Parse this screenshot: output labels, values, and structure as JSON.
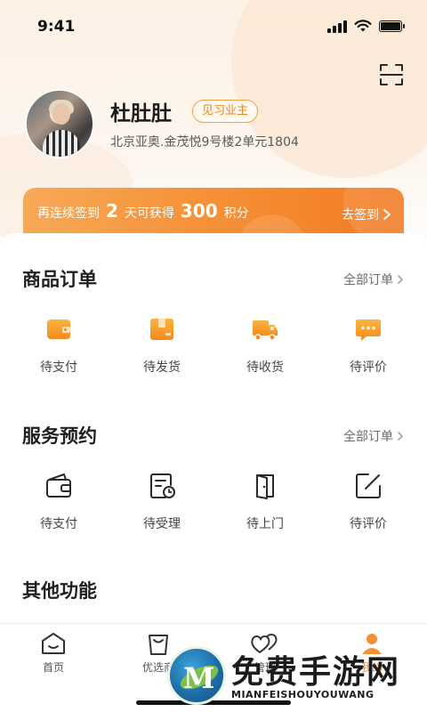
{
  "status_bar": {
    "time": "9:41"
  },
  "profile": {
    "name": "杜肚肚",
    "badge": "见习业主",
    "address": "北京亚奥.金茂悦9号楼2单元1804"
  },
  "signin": {
    "prefix": "再连续签到",
    "days": "2",
    "middle": "天可获得",
    "points": "300",
    "suffix": "积分",
    "action": "去签到"
  },
  "orders": {
    "title": "商品订单",
    "link": "全部订单",
    "items": [
      {
        "label": "待支付",
        "icon": "wallet-icon"
      },
      {
        "label": "待发货",
        "icon": "package-icon"
      },
      {
        "label": "待收货",
        "icon": "truck-icon"
      },
      {
        "label": "待评价",
        "icon": "comment-icon"
      }
    ]
  },
  "services": {
    "title": "服务预约",
    "link": "全部订单",
    "items": [
      {
        "label": "待支付",
        "icon": "wallet-outline-icon"
      },
      {
        "label": "待受理",
        "icon": "schedule-icon"
      },
      {
        "label": "待上门",
        "icon": "door-icon"
      },
      {
        "label": "待评价",
        "icon": "edit-icon"
      }
    ]
  },
  "other": {
    "title": "其他功能"
  },
  "bottom_nav": [
    {
      "label": "首页",
      "icon": "home-icon"
    },
    {
      "label": "优选商",
      "icon": "bag-icon"
    },
    {
      "label": "管理",
      "icon": "hearts-icon"
    },
    {
      "label": "我的",
      "icon": "profile-icon"
    }
  ],
  "watermark": {
    "title": "免费手游网",
    "subtitle": "MIANFEISHOUYOUWANG"
  },
  "colors": {
    "accent": "#f59036",
    "badge": "#f0a24a",
    "text": "#1f1f1f"
  }
}
